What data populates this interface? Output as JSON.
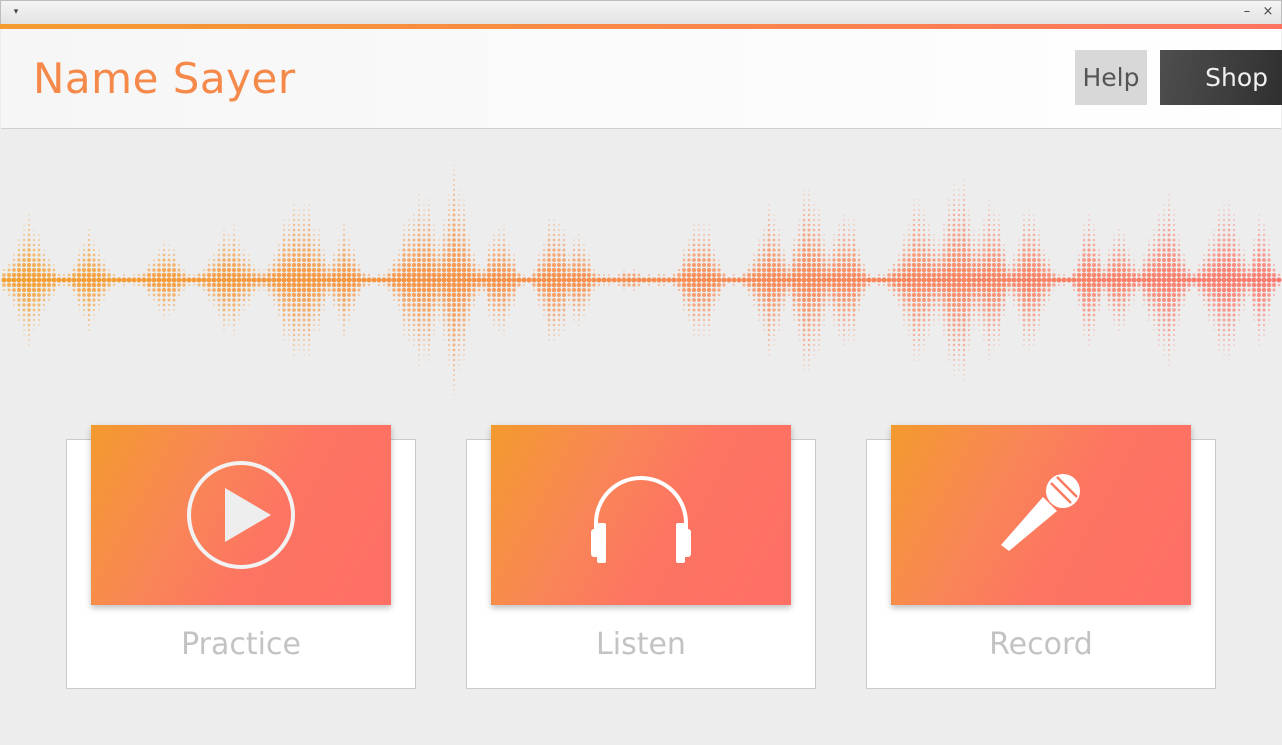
{
  "app": {
    "title": "Name Sayer",
    "accent_start": "#f59b2f",
    "accent_end": "#fc7461"
  },
  "window": {
    "menu_icon": "window-menu-icon",
    "minimize_icon": "window-minimize-icon",
    "close_icon": "window-close-icon",
    "minimize_glyph": "–",
    "close_glyph": "×",
    "menu_glyph": "▾"
  },
  "header": {
    "help_label": "Help",
    "shop_label": "Shop"
  },
  "waveform": {
    "icon": "sound-wave-graphic",
    "color_start": "#f5a030",
    "color_end": "#fc7a70"
  },
  "cards": [
    {
      "label": "Practice",
      "icon": "play-circle-icon"
    },
    {
      "label": "Listen",
      "icon": "headphones-icon"
    },
    {
      "label": "Record",
      "icon": "microphone-icon"
    }
  ]
}
